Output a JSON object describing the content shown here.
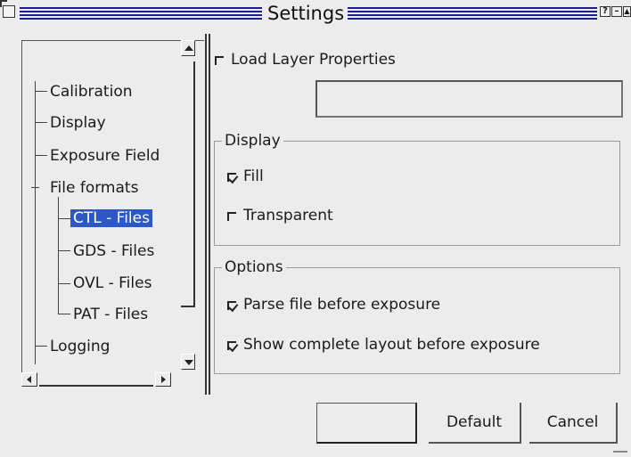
{
  "window": {
    "title": "Settings",
    "help_glyph": "?",
    "minimize_glyph": "–",
    "maximize_glyph": "▲"
  },
  "tree": {
    "items": [
      {
        "label": "Calibration",
        "level": 1
      },
      {
        "label": "Display",
        "level": 1
      },
      {
        "label": "Exposure Field",
        "level": 1
      },
      {
        "label": "File formats",
        "level": 1,
        "expanded": true
      },
      {
        "label": "CTL - Files",
        "level": 2,
        "selected": true
      },
      {
        "label": "GDS - Files",
        "level": 2
      },
      {
        "label": "OVL - Files",
        "level": 2
      },
      {
        "label": "PAT - Files",
        "level": 2
      },
      {
        "label": "Logging",
        "level": 1
      }
    ]
  },
  "main": {
    "load_layer": {
      "label": "Load Layer Properties",
      "checked": false
    },
    "layer_file": {
      "value": "",
      "placeholder": ""
    },
    "display_group": {
      "title": "Display",
      "fill": {
        "label": "Fill",
        "checked": true
      },
      "transparent": {
        "label": "Transparent",
        "checked": false
      }
    },
    "options_group": {
      "title": "Options",
      "parse": {
        "label": "Parse file before exposure",
        "checked": true
      },
      "show_layout": {
        "label": "Show complete layout before exposure",
        "checked": true
      }
    }
  },
  "buttons": {
    "ok": "",
    "default": "Default",
    "cancel": "Cancel"
  },
  "colors": {
    "selection": "#2d57c7",
    "titlebar_stripes": "#1e1e8c",
    "background": "#ececec"
  }
}
